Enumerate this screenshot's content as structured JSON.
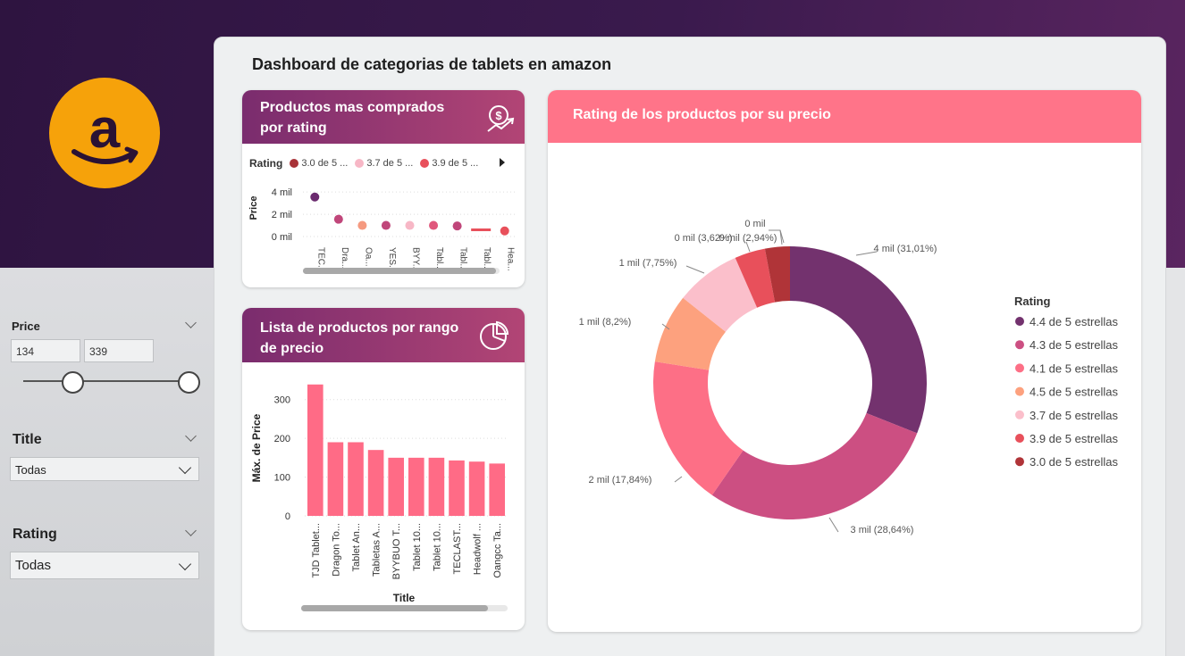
{
  "dashboard": {
    "title": "Dashboard de categorias de tablets en amazon"
  },
  "logo": {
    "letter": "a",
    "color": "#f6a20a"
  },
  "slicers": {
    "price": {
      "label": "Price",
      "min_value": "134",
      "max_value": "339"
    },
    "title": {
      "label": "Title",
      "selected": "Todas"
    },
    "rating": {
      "label": "Rating",
      "selected": "Todas"
    }
  },
  "card_top": {
    "title": "Productos mas comprados por rating",
    "icon": "money-up-icon",
    "legend_title": "Rating",
    "legend": [
      {
        "label": "3.0 de 5 ...",
        "color": "#a83238"
      },
      {
        "label": "3.7 de 5 ...",
        "color": "#f7b7c6"
      },
      {
        "label": "3.9 de 5 ...",
        "color": "#e8505b"
      }
    ]
  },
  "card_bar": {
    "title": "Lista de productos por rango de precio",
    "icon": "pie-icon"
  },
  "card_donut": {
    "title": "Rating de los productos por su precio",
    "legend_title": "Rating"
  },
  "chart_data": [
    {
      "type": "scatter",
      "ylabel": "Price",
      "ytick_labels": [
        "4 mil",
        "2 mil",
        "0 mil"
      ],
      "ylim": [
        0,
        4500
      ],
      "categories": [
        "TEC...",
        "Dra...",
        "Oa...",
        "YES...",
        "BYY...",
        "Tabl...",
        "Tabl...",
        "Tabl...",
        "Hea..."
      ],
      "values": [
        3550,
        1550,
        1000,
        1000,
        1000,
        1000,
        950,
        600,
        500
      ],
      "colors": [
        "#6a2a6e",
        "#c0467a",
        "#f59a80",
        "#c0467a",
        "#f7b7c6",
        "#e0577c",
        "#c0467a",
        "#e8505b",
        "#e8505b"
      ]
    },
    {
      "type": "bar",
      "xlabel": "Title",
      "ylabel": "Máx. de Price",
      "ylim": [
        0,
        350
      ],
      "yticks": [
        "0",
        "100",
        "200",
        "300"
      ],
      "categories": [
        "TJD Tablet...",
        "Dragon To...",
        "Tablet An...",
        "Tabletas A...",
        "BYYBUO T...",
        "Tablet 10...",
        "Tablet 10...",
        "TECLAST...",
        "Headwolf ...",
        "Oangcc Ta..."
      ],
      "values": [
        339,
        190,
        190,
        170,
        150,
        150,
        150,
        143,
        140,
        135
      ],
      "color": "#ff6b86"
    },
    {
      "type": "pie",
      "donut": true,
      "slices": [
        {
          "label": "4.4 de 5 estrellas",
          "value": 31.01,
          "data_label": "4 mil (31,01%)",
          "color": "#73326e"
        },
        {
          "label": "4.3 de 5 estrellas",
          "value": 28.64,
          "data_label": "3 mil (28,64%)",
          "color": "#cc4f82"
        },
        {
          "label": "4.1 de 5 estrellas",
          "value": 17.84,
          "data_label": "2 mil (17,84%)",
          "color": "#fd6f86"
        },
        {
          "label": "4.5 de 5 estrellas",
          "value": 8.2,
          "data_label": "1 mil (8,2%)",
          "color": "#fda17e"
        },
        {
          "label": "3.7 de 5 estrellas",
          "value": 7.75,
          "data_label": "1 mil (7,75%)",
          "color": "#fbbfcb"
        },
        {
          "label": "3.9 de 5 estrellas",
          "value": 3.62,
          "data_label": "0 mil (3,62%)",
          "color": "#e8505b"
        },
        {
          "label": "3.0 de 5 estrellas",
          "value": 2.94,
          "data_label": "0 mil (2,94%)",
          "color": "#b03438"
        }
      ],
      "extra_label": "0 mil"
    }
  ]
}
